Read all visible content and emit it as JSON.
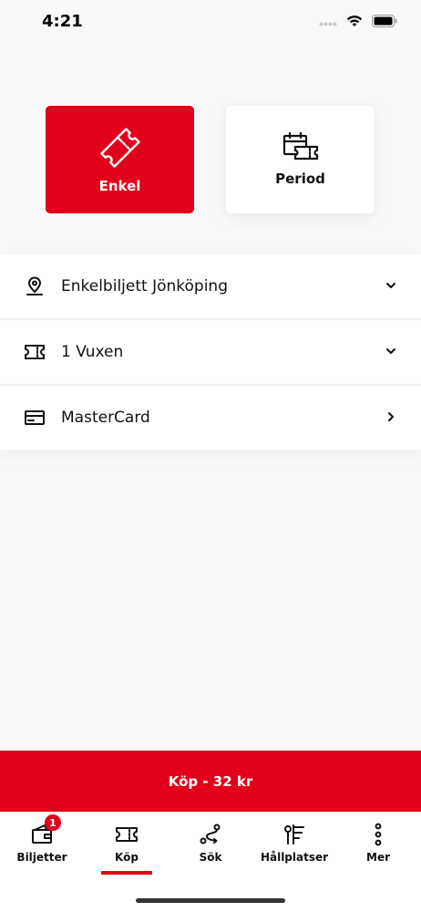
{
  "status_bar": {
    "time": "4:21"
  },
  "ticket_types": [
    {
      "label": "Enkel",
      "icon": "ticket-icon",
      "selected": true
    },
    {
      "label": "Period",
      "icon": "calendar-ticket-icon",
      "selected": false
    }
  ],
  "options": [
    {
      "label": "Enkelbiljett Jönköping",
      "icon": "location-pin-icon",
      "action": "chevron-down-icon"
    },
    {
      "label": "1 Vuxen",
      "icon": "ticket-icon",
      "action": "chevron-down-icon"
    },
    {
      "label": "MasterCard",
      "icon": "credit-card-icon",
      "action": "chevron-right-icon"
    }
  ],
  "buy_button": {
    "label": "Köp - 32 kr"
  },
  "tabs": [
    {
      "label": "Biljetter",
      "icon": "wallet-icon",
      "badge": "1"
    },
    {
      "label": "Köp",
      "icon": "ticket-icon",
      "active": true
    },
    {
      "label": "Sök",
      "icon": "route-icon"
    },
    {
      "label": "Hållplatser",
      "icon": "bus-stop-icon"
    },
    {
      "label": "Mer",
      "icon": "more-vertical-icon"
    }
  ],
  "colors": {
    "accent": "#e2001a",
    "background": "#f9f9fb",
    "card": "#ffffff"
  }
}
